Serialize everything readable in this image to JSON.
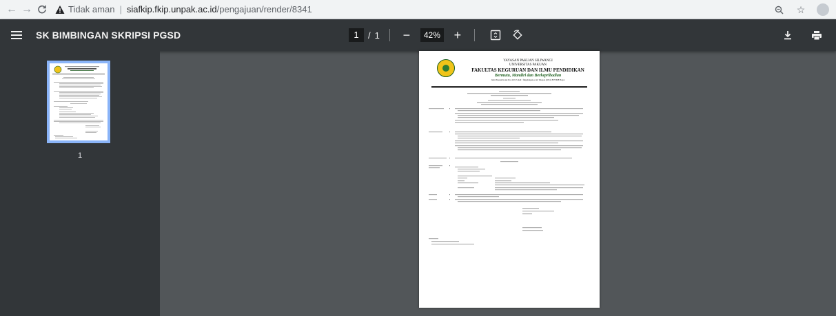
{
  "browser": {
    "security_label": "Tidak aman",
    "host": "siafkip.fkip.unpak.ac.id",
    "path": "/pengajuan/render/8341"
  },
  "viewer": {
    "title": "SK BIMBINGAN SKRIPSI PGSD",
    "current_page": "1",
    "page_separator": "/",
    "total_pages": "1",
    "zoom": "42%",
    "zoom_out_label": "−",
    "zoom_in_label": "+",
    "thumbnail_label": "1"
  },
  "document": {
    "header": {
      "line1": "YAYASAN PAKUAN SILIWANGI",
      "line2": "UNIVERSITAS PAKUAN",
      "line3": "FAKULTAS KEGURUAN DAN ILMU PENDIDIKAN",
      "motto": "Bermutu, Mandiri dan Berkepribadian",
      "address": "Jalan Pakuan Kotak Pos 452, E-mail : fkip@unpak.ac.id, Telepon (0251) 8375608 Bogor"
    }
  },
  "colors": {
    "toolbar_bg": "#323639",
    "viewer_bg": "#525659",
    "thumb_selected": "#8ab4f8",
    "motto_green": "#1a5d1a"
  }
}
